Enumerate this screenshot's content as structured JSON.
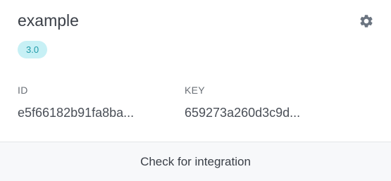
{
  "card": {
    "title": "example",
    "version": "3.0",
    "settings_icon": "gear-icon",
    "fields": {
      "id": {
        "label": "ID",
        "value": "e5f66182b91fa8ba..."
      },
      "key": {
        "label": "KEY",
        "value": "659273a260d3c9d..."
      }
    },
    "action": {
      "label": "Check for integration"
    }
  },
  "colors": {
    "badge_bg": "#c7f0f5",
    "badge_text": "#1f9aa8",
    "gear": "#6b7480",
    "footer_bg": "#f7f8fa"
  }
}
